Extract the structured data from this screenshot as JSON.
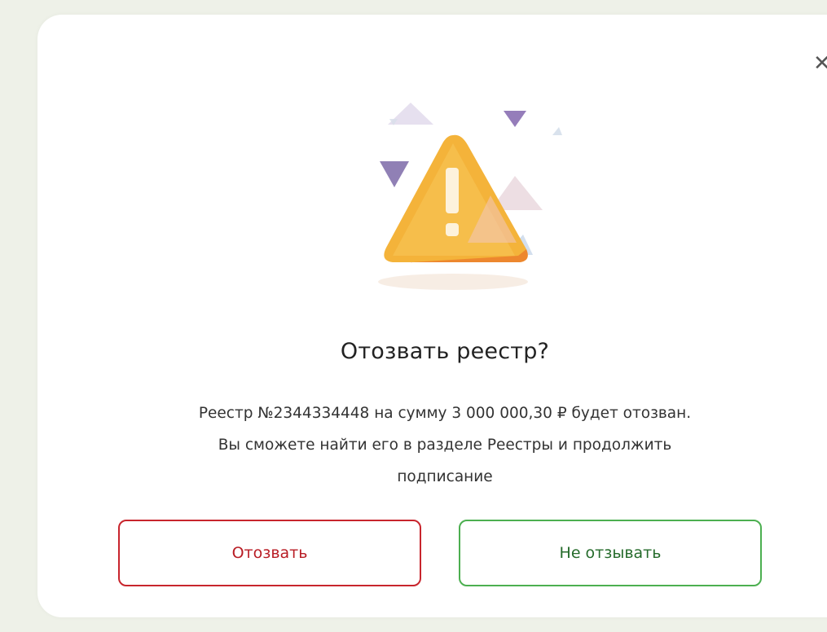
{
  "dialog": {
    "close_icon": "close-icon",
    "illustration_icon": "warning-triangle-icon",
    "title": "Отозвать реестр?",
    "message_lines": [
      "Реестр №2344334448 на сумму 3 000 000,30 ₽ будет отозван.",
      "Вы сможете найти его в разделе Реестры и продолжить",
      "подписание"
    ],
    "revoke_label": "Отозвать",
    "cancel_label": "Не отзывать",
    "colors": {
      "revoke": "#c8252d",
      "cancel": "#4caf50",
      "warning": "#f5b72e"
    }
  }
}
